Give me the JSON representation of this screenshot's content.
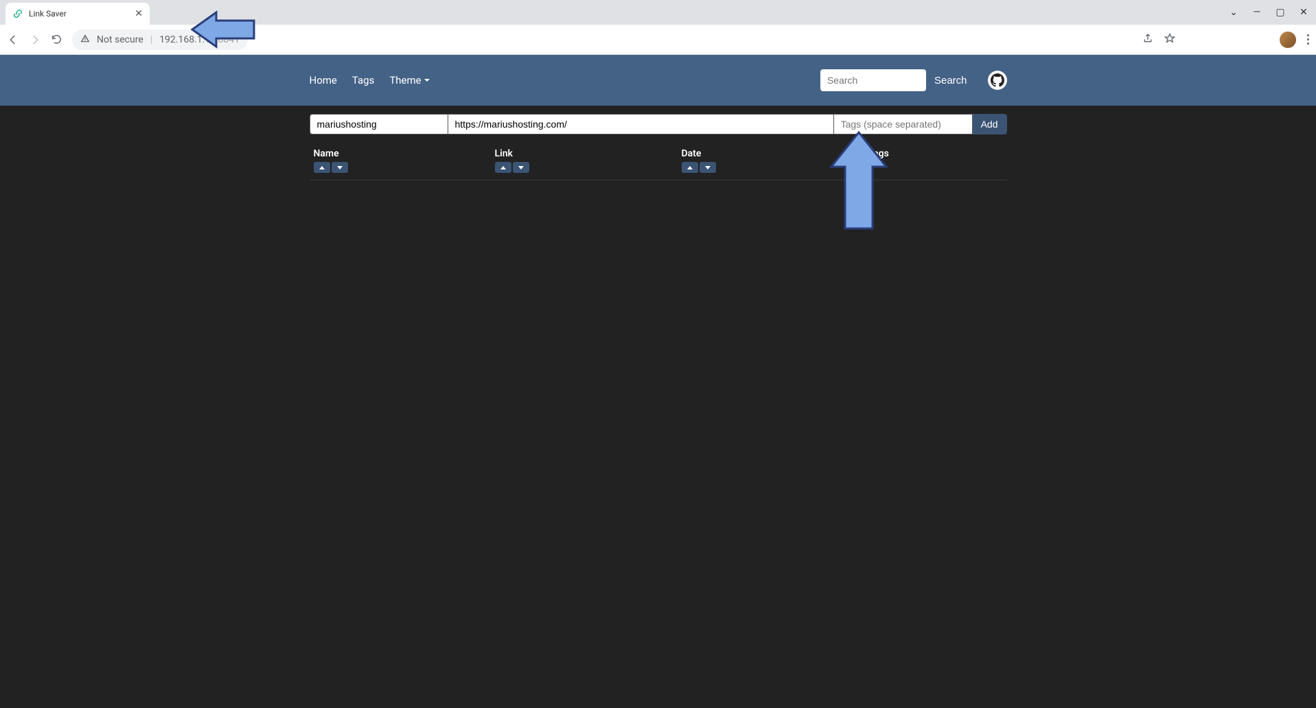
{
  "browser": {
    "tab_title": "Link Saver",
    "not_secure_label": "Not secure",
    "url_host": "192.168.1.18:",
    "url_port": "8841"
  },
  "nav": {
    "home": "Home",
    "tags": "Tags",
    "theme": "Theme"
  },
  "search": {
    "placeholder": "Search",
    "button": "Search"
  },
  "form": {
    "name_value": "mariushosting",
    "link_value": "https://mariushosting.com/",
    "tags_placeholder": "Tags (space separated)",
    "add_label": "Add"
  },
  "columns": {
    "name": "Name",
    "link": "Link",
    "date": "Date",
    "tags": "Tags"
  }
}
